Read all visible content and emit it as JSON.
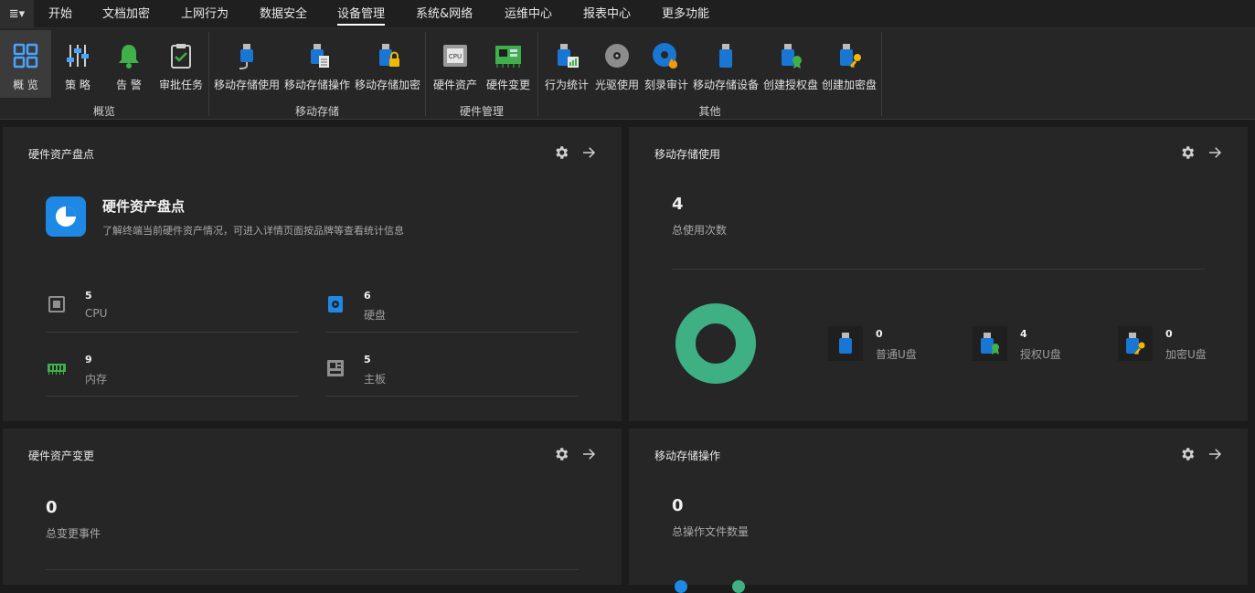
{
  "menu": {
    "app_icon": "≣▾",
    "tabs": [
      "开始",
      "文档加密",
      "上网行为",
      "数据安全",
      "设备管理",
      "系统&网络",
      "运维中心",
      "报表中心",
      "更多功能"
    ],
    "active_tab": "设备管理"
  },
  "ribbon": {
    "buttons": [
      "概 览",
      "策 略",
      "告 警",
      "审批任务",
      "移动存储使用",
      "移动存储操作",
      "移动存储加密",
      "硬件资产",
      "硬件变更",
      "行为统计",
      "光驱使用",
      "刻录审计",
      "移动存储设备",
      "创建授权盘",
      "创建加密盘"
    ],
    "groups": [
      "概览",
      "移动存储",
      "硬件管理",
      "其他"
    ]
  },
  "hw_inventory": {
    "title": "硬件资产盘点",
    "intro_title": "硬件资产盘点",
    "intro_desc": "了解终端当前硬件资产情况，可进入详情页面按品牌等查看统计信息",
    "items": [
      {
        "value": "5",
        "label": "CPU",
        "icon": "cpu-icon"
      },
      {
        "value": "6",
        "label": "硬盘",
        "icon": "disk-icon"
      },
      {
        "value": "9",
        "label": "内存",
        "icon": "memory-icon"
      },
      {
        "value": "5",
        "label": "主板",
        "icon": "motherboard-icon"
      }
    ]
  },
  "usb_usage": {
    "title": "移动存储使用",
    "total": "4",
    "total_label": "总使用次数",
    "donut_color": "#3fb083",
    "legend": [
      {
        "value": "0",
        "label": "普通U盘",
        "icon": "usb-normal-icon"
      },
      {
        "value": "4",
        "label": "授权U盘",
        "icon": "usb-authorized-icon"
      },
      {
        "value": "0",
        "label": "加密U盘",
        "icon": "usb-encrypted-icon"
      }
    ]
  },
  "hw_change": {
    "title": "硬件资产变更",
    "total": "0",
    "total_label": "总变更事件"
  },
  "usb_ops": {
    "title": "移动存储操作",
    "total": "0",
    "total_label": "总操作文件数量"
  },
  "colors": {
    "accent_blue": "#1e88e5",
    "green": "#3fb083",
    "usb_blue": "#1976d2"
  }
}
